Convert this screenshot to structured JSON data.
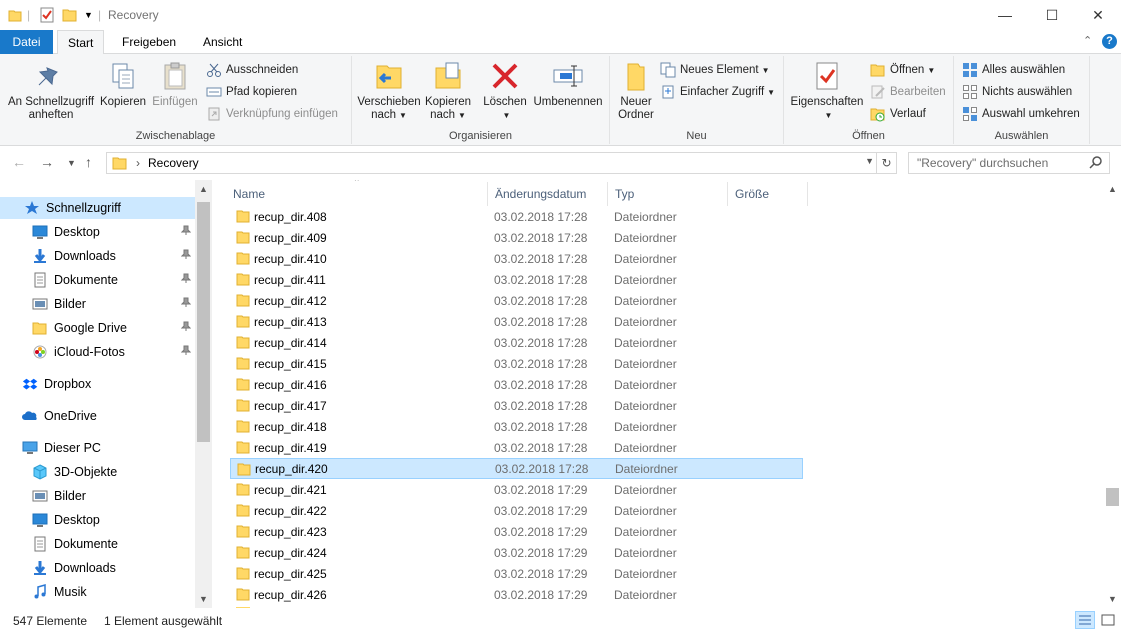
{
  "window": {
    "title": "Recovery",
    "minimize": "—",
    "maximize": "☐",
    "close": "✕"
  },
  "ribbon_tabs": [
    "Datei",
    "Start",
    "Freigeben",
    "Ansicht"
  ],
  "ribbon": {
    "clipboard": {
      "pin_quick_access": [
        "An Schnellzugriff",
        "anheften"
      ],
      "copy": "Kopieren",
      "paste": "Einfügen",
      "cut": "Ausschneiden",
      "copy_path": "Pfad kopieren",
      "paste_shortcut": "Verknüpfung einfügen",
      "label": "Zwischenablage"
    },
    "organize": {
      "move_to": [
        "Verschieben",
        "nach"
      ],
      "copy_to": [
        "Kopieren",
        "nach"
      ],
      "delete": "Löschen",
      "rename": "Umbenennen",
      "label": "Organisieren"
    },
    "new": {
      "new_folder": [
        "Neuer",
        "Ordner"
      ],
      "new_item": "Neues Element",
      "easy_access": "Einfacher Zugriff",
      "label": "Neu"
    },
    "open": {
      "properties": "Eigenschaften",
      "open": "Öffnen",
      "edit": "Bearbeiten",
      "history": "Verlauf",
      "label": "Öffnen"
    },
    "select": {
      "select_all": "Alles auswählen",
      "select_none": "Nichts auswählen",
      "invert": "Auswahl umkehren",
      "label": "Auswählen"
    }
  },
  "address": {
    "path": "Recovery",
    "separator": "›",
    "search_placeholder": "\"Recovery\" durchsuchen"
  },
  "nav": {
    "quick_access": "Schnellzugriff",
    "quick_items": [
      {
        "label": "Desktop",
        "icon": "desktop-icon"
      },
      {
        "label": "Downloads",
        "icon": "downloads-icon"
      },
      {
        "label": "Dokumente",
        "icon": "documents-icon"
      },
      {
        "label": "Bilder",
        "icon": "pictures-icon"
      },
      {
        "label": "Google Drive",
        "icon": "folder-icon"
      },
      {
        "label": "iCloud-Fotos",
        "icon": "icloud-photos-icon"
      }
    ],
    "dropbox": "Dropbox",
    "onedrive": "OneDrive",
    "this_pc": "Dieser PC",
    "pc_items": [
      {
        "label": "3D-Objekte",
        "icon": "3d-objects-icon"
      },
      {
        "label": "Bilder",
        "icon": "pictures-icon"
      },
      {
        "label": "Desktop",
        "icon": "desktop-icon"
      },
      {
        "label": "Dokumente",
        "icon": "documents-icon"
      },
      {
        "label": "Downloads",
        "icon": "downloads-icon"
      },
      {
        "label": "Musik",
        "icon": "music-icon"
      }
    ]
  },
  "columns": {
    "name": "Name",
    "date": "Änderungsdatum",
    "type": "Typ",
    "size": "Größe"
  },
  "files": [
    {
      "name": "recup_dir.408",
      "date": "03.02.2018 17:28",
      "type": "Dateiordner"
    },
    {
      "name": "recup_dir.409",
      "date": "03.02.2018 17:28",
      "type": "Dateiordner"
    },
    {
      "name": "recup_dir.410",
      "date": "03.02.2018 17:28",
      "type": "Dateiordner"
    },
    {
      "name": "recup_dir.411",
      "date": "03.02.2018 17:28",
      "type": "Dateiordner"
    },
    {
      "name": "recup_dir.412",
      "date": "03.02.2018 17:28",
      "type": "Dateiordner"
    },
    {
      "name": "recup_dir.413",
      "date": "03.02.2018 17:28",
      "type": "Dateiordner"
    },
    {
      "name": "recup_dir.414",
      "date": "03.02.2018 17:28",
      "type": "Dateiordner"
    },
    {
      "name": "recup_dir.415",
      "date": "03.02.2018 17:28",
      "type": "Dateiordner"
    },
    {
      "name": "recup_dir.416",
      "date": "03.02.2018 17:28",
      "type": "Dateiordner"
    },
    {
      "name": "recup_dir.417",
      "date": "03.02.2018 17:28",
      "type": "Dateiordner"
    },
    {
      "name": "recup_dir.418",
      "date": "03.02.2018 17:28",
      "type": "Dateiordner"
    },
    {
      "name": "recup_dir.419",
      "date": "03.02.2018 17:28",
      "type": "Dateiordner"
    },
    {
      "name": "recup_dir.420",
      "date": "03.02.2018 17:28",
      "type": "Dateiordner",
      "selected": true
    },
    {
      "name": "recup_dir.421",
      "date": "03.02.2018 17:29",
      "type": "Dateiordner"
    },
    {
      "name": "recup_dir.422",
      "date": "03.02.2018 17:29",
      "type": "Dateiordner"
    },
    {
      "name": "recup_dir.423",
      "date": "03.02.2018 17:29",
      "type": "Dateiordner"
    },
    {
      "name": "recup_dir.424",
      "date": "03.02.2018 17:29",
      "type": "Dateiordner"
    },
    {
      "name": "recup_dir.425",
      "date": "03.02.2018 17:29",
      "type": "Dateiordner"
    },
    {
      "name": "recup_dir.426",
      "date": "03.02.2018 17:29",
      "type": "Dateiordner"
    }
  ],
  "status": {
    "count": "547 Elemente",
    "selection": "1 Element ausgewählt"
  },
  "colors": {
    "accent": "#1979ca",
    "selection": "#cce8ff",
    "selection_border": "#99d1ff",
    "folder": "#ffd866"
  }
}
